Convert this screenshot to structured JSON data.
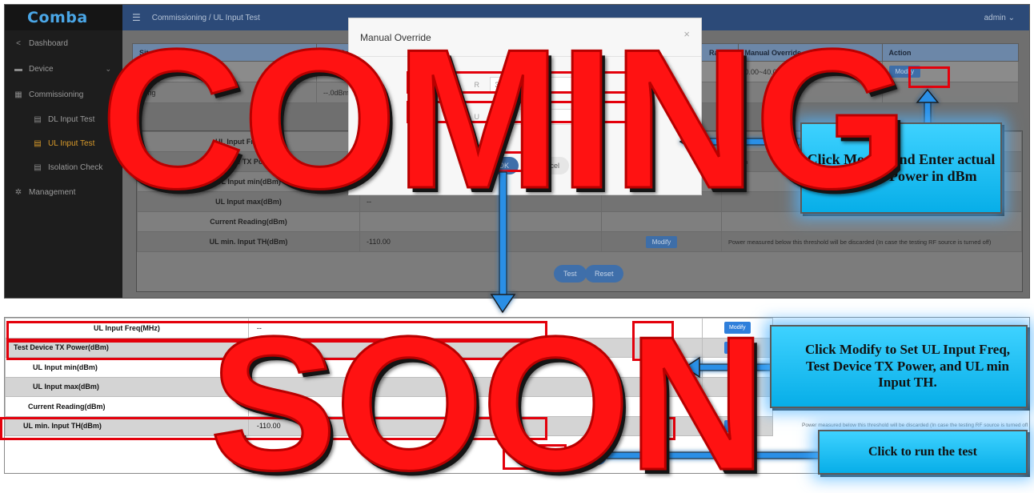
{
  "app": {
    "logo": "Comba",
    "breadcrumb": "Commissioning  /  UL Input Test",
    "user": "admin"
  },
  "sidebar": {
    "items": [
      {
        "label": "Dashboard"
      },
      {
        "label": "Device"
      },
      {
        "label": "Commissioning"
      },
      {
        "label": "DL Input Test"
      },
      {
        "label": "UL Input Test"
      },
      {
        "label": "Isolation Check"
      },
      {
        "label": "Management"
      }
    ]
  },
  "site_table": {
    "headers": [
      "Site Name",
      "Test Re",
      "Range",
      "Manual Override",
      "Action"
    ],
    "row1": {
      "manual_override": "0.00~40.00dBm",
      "action": "Modify"
    },
    "row2": {
      "site_name": "trehg",
      "test_result": "--.0dBm"
    }
  },
  "config": {
    "rows": [
      {
        "label": "UL Input Freq(MHz)",
        "value": "--"
      },
      {
        "label": "Test Device TX Power(dBm)",
        "value": "",
        "note": "or uplin"
      },
      {
        "label": "UL Input min(dBm)",
        "value": "--"
      },
      {
        "label": "UL Input max(dBm)",
        "value": "--"
      },
      {
        "label": "Current Reading(dBm)",
        "value": ""
      },
      {
        "label": "UL min. Input TH(dBm)",
        "value": "-110.00",
        "action": "Modify",
        "note": "Power measured below this threshold will be discarded (In case the testing RF source is turned off)"
      }
    ],
    "test_label": "Test",
    "reset_label": "Reset"
  },
  "modal": {
    "title": "Manual Override",
    "close": "×",
    "field1_label": "R",
    "field1_value": "35",
    "field2_label": "U",
    "field2_value": "Devi",
    "ok_label": "OK",
    "cancel_label": "Cancel"
  },
  "zoom": {
    "rows": [
      {
        "label": "UL Input Freq(MHz)",
        "value": "--",
        "action": "Modify"
      },
      {
        "label": "Test Device TX Power(dBm)",
        "value": "",
        "action": "Modify"
      },
      {
        "label": "UL Input min(dBm)",
        "value": "",
        "action": ""
      },
      {
        "label": "UL Input max(dBm)",
        "value": "",
        "action": ""
      },
      {
        "label": "Current Reading(dBm)",
        "value": "",
        "action": ""
      },
      {
        "label": "UL min. Input TH(dBm)",
        "value": "-110.00",
        "action": ""
      }
    ],
    "note": "Power measured below this threshold will be discarded (In case the testing RF source is turned off)",
    "test_label": "Test",
    "reset_label": "Reset"
  },
  "callouts": {
    "modify": "Click Modify and Enter actual Radio TX Power in dBm",
    "set": "Click Modify to Set UL Input Freq, Test Device TX Power, and UL min Input TH.",
    "run": "Click to run the test"
  },
  "watermark": {
    "line1": "COMING",
    "line2": "SOON"
  },
  "colors": {
    "highlight": "#e3000b",
    "callout": "#18c0f0",
    "watermark": "#ff1212",
    "topbar": "#2c4a78"
  }
}
